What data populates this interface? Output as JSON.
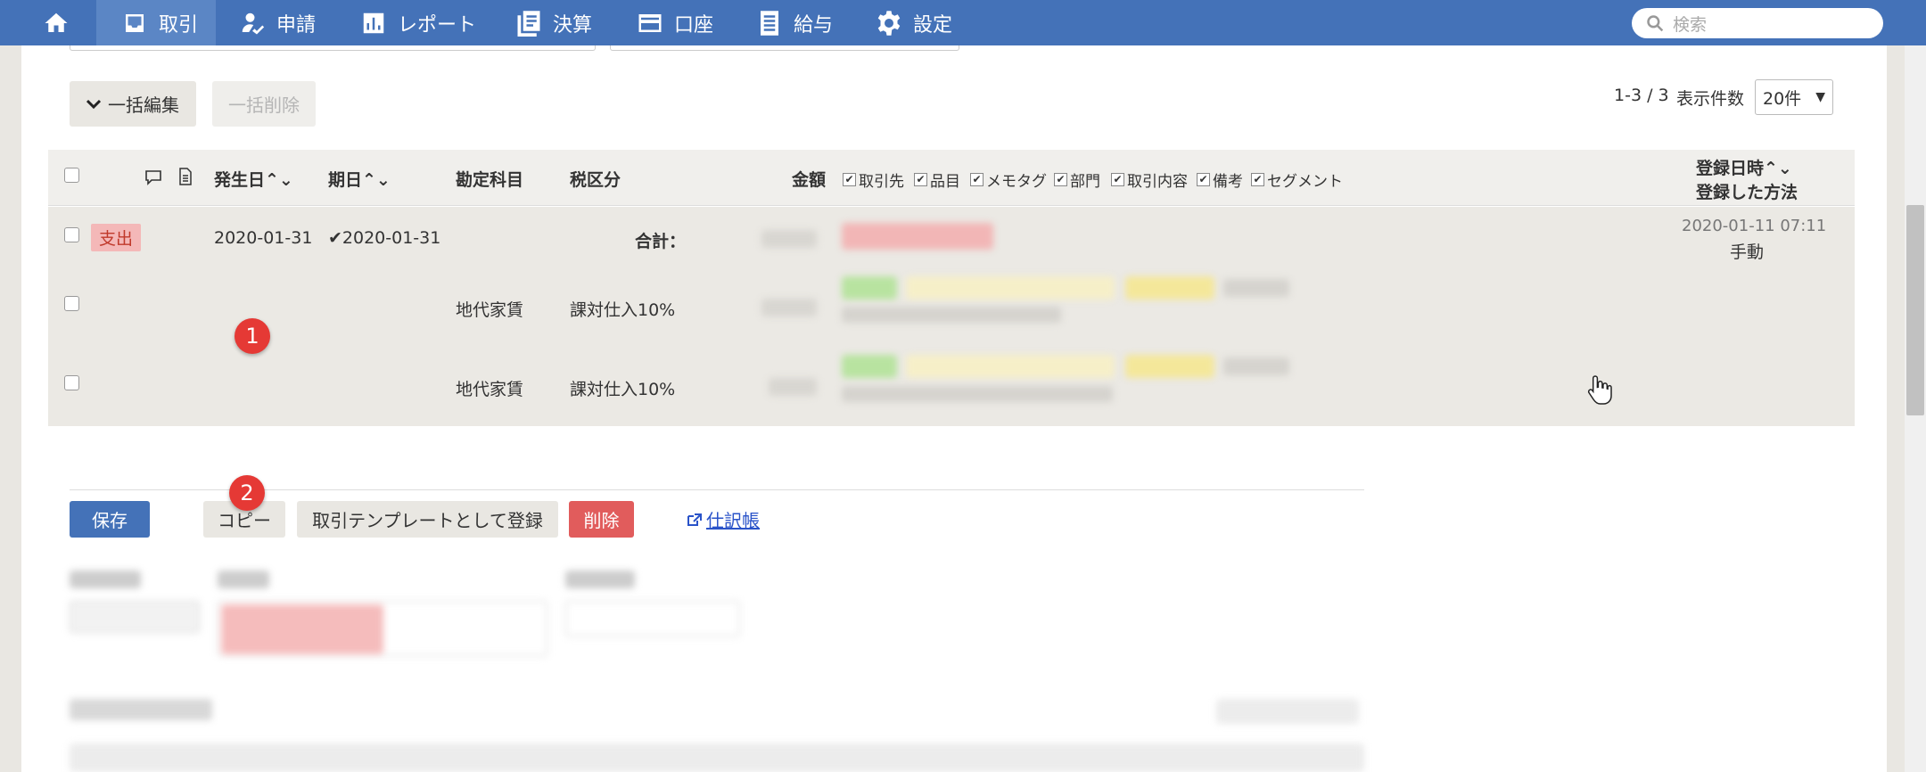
{
  "nav": {
    "items": [
      {
        "label": ""
      },
      {
        "label": "取引"
      },
      {
        "label": "申請"
      },
      {
        "label": "レポート"
      },
      {
        "label": "決算"
      },
      {
        "label": "口座"
      },
      {
        "label": "給与"
      },
      {
        "label": "設定"
      }
    ],
    "search_placeholder": "検索"
  },
  "toolbar": {
    "bulk_edit": "一括編集",
    "bulk_delete": "一括削除",
    "paging": "1-3 / 3",
    "per_page_label": "表示件数",
    "per_page_value": "20件"
  },
  "table": {
    "headers": {
      "date": "発生日",
      "due": "期日",
      "account": "勘定科目",
      "tax": "税区分",
      "amount": "金額",
      "registered_at": "登録日時",
      "method": "登録した方法"
    },
    "column_options": [
      "取引先",
      "品目",
      "メモタグ",
      "部門",
      "取引内容",
      "備考",
      "セグメント"
    ],
    "rows": [
      {
        "type_badge": "支出",
        "date": "2020-01-31",
        "due": "2020-01-31",
        "total_label": "合計：",
        "registered_at": "2020-01-11 07:11",
        "method": "手動"
      },
      {
        "account": "地代家賃",
        "tax": "課対仕入10%"
      },
      {
        "account": "地代家賃",
        "tax": "課対仕入10%"
      }
    ]
  },
  "actions": {
    "save": "保存",
    "copy": "コピー",
    "template": "取引テンプレートとして登録",
    "delete": "削除",
    "journal": "仕訳帳"
  },
  "markers": [
    "1",
    "2"
  ],
  "colors": {
    "nav": "#4472b8",
    "danger": "#e15c5c",
    "link": "#2a53c9"
  }
}
